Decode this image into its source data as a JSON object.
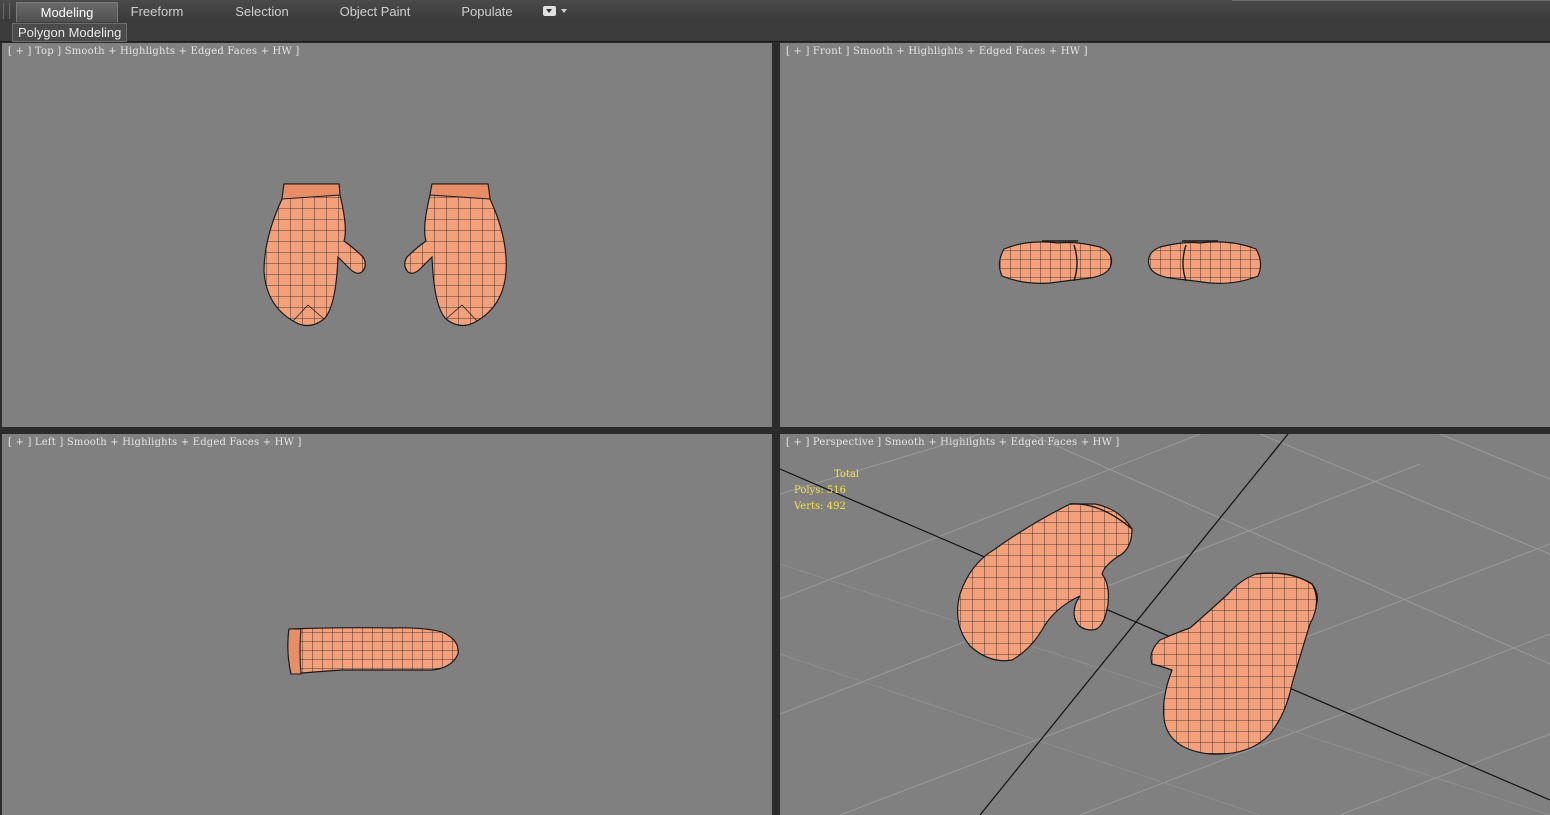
{
  "ribbon": {
    "tabs": [
      {
        "label": "Modeling",
        "active": true
      },
      {
        "label": "Freeform",
        "active": false
      },
      {
        "label": "Selection",
        "active": false
      },
      {
        "label": "Object Paint",
        "active": false
      },
      {
        "label": "Populate",
        "active": false
      }
    ],
    "dropdown_icon": "ribbon-options-icon",
    "panel_label": "Polygon Modeling"
  },
  "viewports": {
    "top": {
      "label": "[ + ] Top ] Smooth + Highlights + Edged Faces + HW ]"
    },
    "front": {
      "label": "[ + ] Front ] Smooth + Highlights + Edged Faces + HW ]"
    },
    "left": {
      "label": "[ + ] Left ] Smooth + Highlights + Edged Faces + HW ]"
    },
    "perspective": {
      "label": "[ + ] Perspective ] Smooth + Highlights + Edged Faces + HW ]",
      "stats": {
        "header": "Total",
        "polys_label": "Polys:",
        "polys_value": "516",
        "verts_label": "Verts:",
        "verts_value": "492"
      }
    }
  },
  "colors": {
    "viewport_bg": "#808080",
    "mesh_fill": "#f4a07a",
    "mesh_wire": "#1a1a1a",
    "stats_text": "#f4e34a"
  }
}
